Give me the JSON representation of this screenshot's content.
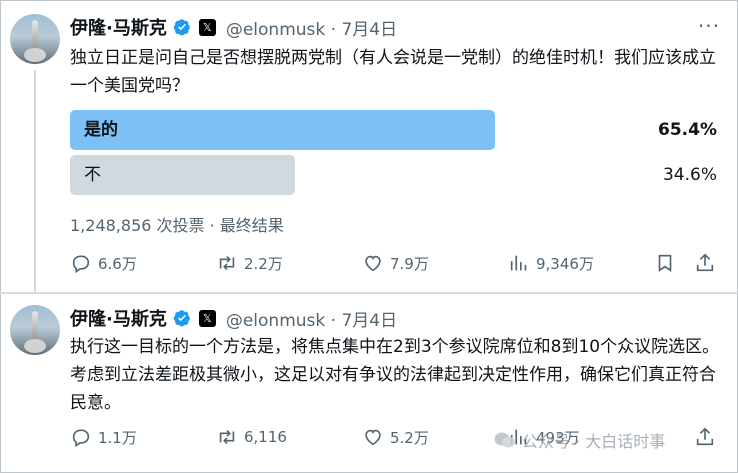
{
  "tweets": [
    {
      "author_name": "伊隆·马斯克",
      "handle_date": "@elonmusk · 7月4日",
      "text": "独立日正是问自己是否想摆脱两党制（有人会说是一党制）的绝佳时机！我们应该成立一个美国党吗？",
      "poll": {
        "options": [
          {
            "label": "是的",
            "percent": "65.4%",
            "fraction": 0.654,
            "winner": true
          },
          {
            "label": "不",
            "percent": "34.6%",
            "fraction": 0.346,
            "winner": false
          }
        ],
        "summary": "1,248,856 次投票 · 最终结果"
      },
      "stats": {
        "replies": "6.6万",
        "reposts": "2.2万",
        "likes": "7.9万",
        "views": "9,346万"
      }
    },
    {
      "author_name": "伊隆·马斯克",
      "handle_date": "@elonmusk · 7月4日",
      "text": "执行这一目标的一个方法是，将焦点集中在2到3个参议院席位和8到10个众议院选区。考虑到立法差距极其微小，这足以对有争议的法律起到决定性作用，确保它们真正符合民意。",
      "stats": {
        "replies": "1.1万",
        "reposts": "6,116",
        "likes": "5.2万",
        "views": "493万"
      }
    }
  ],
  "watermark": "公众号 · 大白话时事",
  "colors": {
    "poll_winner": "#7cc0f5",
    "poll_other": "#cfd9de",
    "verified": "#1d9bf0",
    "muted": "#536471"
  }
}
